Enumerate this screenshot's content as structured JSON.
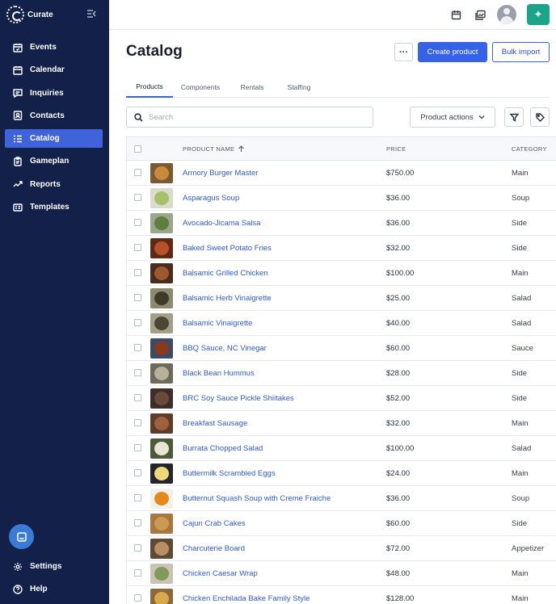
{
  "app": {
    "logo_text": "Curate",
    "page_title": "Catalog"
  },
  "sidebar": {
    "items": [
      {
        "label": "Events",
        "icon": "calendar-check-icon",
        "active": false
      },
      {
        "label": "Calendar",
        "icon": "calendar-icon",
        "active": false
      },
      {
        "label": "Inquiries",
        "icon": "message-icon",
        "active": false
      },
      {
        "label": "Contacts",
        "icon": "contact-card-icon",
        "active": false
      },
      {
        "label": "Catalog",
        "icon": "list-icon",
        "active": true
      },
      {
        "label": "Gameplan",
        "icon": "clipboard-icon",
        "active": false
      },
      {
        "label": "Reports",
        "icon": "trend-icon",
        "active": false
      },
      {
        "label": "Templates",
        "icon": "template-icon",
        "active": false
      }
    ],
    "bottom_items": [
      {
        "label": "Settings",
        "icon": "gear-icon"
      },
      {
        "label": "Help",
        "icon": "help-icon"
      }
    ]
  },
  "header": {
    "more_label": "···",
    "create_label": "Create product",
    "import_label": "Bulk import"
  },
  "tabs": [
    {
      "label": "Products",
      "active": true
    },
    {
      "label": "Components",
      "active": false
    },
    {
      "label": "Rentals",
      "active": false
    },
    {
      "label": "Staffing",
      "active": false
    }
  ],
  "toolbar": {
    "search_placeholder": "Search",
    "actions_label": "Product actions"
  },
  "table": {
    "columns": {
      "name": "PRODUCT NAME",
      "price": "PRICE",
      "category": "CATEGORY"
    },
    "rows": [
      {
        "name": "Armory Burger Master",
        "price": "$750.00",
        "category": "Main",
        "bg": "#7a5a32",
        "food": "#c98b3a"
      },
      {
        "name": "Asparagus Soup",
        "price": "$36.00",
        "category": "Soup",
        "bg": "#d9dccb",
        "food": "#a7c06a"
      },
      {
        "name": "Avocado-Jicama Salsa",
        "price": "$36.00",
        "category": "Side",
        "bg": "#9aa58b",
        "food": "#5f7d3e"
      },
      {
        "name": "Baked Sweet Potato Fries",
        "price": "$32.00",
        "category": "Side",
        "bg": "#5c2b18",
        "food": "#b9502a"
      },
      {
        "name": "Balsamic Grilled Chicken",
        "price": "$100.00",
        "category": "Main",
        "bg": "#4a2c1c",
        "food": "#9a5a2e"
      },
      {
        "name": "Balsamic Herb Vinaigrette",
        "price": "$25.00",
        "category": "Salad",
        "bg": "#8c8a6e",
        "food": "#3d3a2a"
      },
      {
        "name": "Balsamic Vinaigrette",
        "price": "$40.00",
        "category": "Salad",
        "bg": "#a39e86",
        "food": "#4c4636"
      },
      {
        "name": "BBQ Sauce, NC Vinegar",
        "price": "$60.00",
        "category": "Sauce",
        "bg": "#3b4a66",
        "food": "#8a3a1c"
      },
      {
        "name": "Black Bean Hummus",
        "price": "$28.00",
        "category": "Side",
        "bg": "#6e6a5a",
        "food": "#b7b09a"
      },
      {
        "name": "BRC Soy Sauce Pickle Shiitakes",
        "price": "$52.00",
        "category": "Side",
        "bg": "#3e2e2a",
        "food": "#6b4a3c"
      },
      {
        "name": "Breakfast Sausage",
        "price": "$32.00",
        "category": "Main",
        "bg": "#5e3b2a",
        "food": "#a0603c"
      },
      {
        "name": "Burrata Chopped Salad",
        "price": "$100.00",
        "category": "Salad",
        "bg": "#4d5a3a",
        "food": "#e8e3d4"
      },
      {
        "name": "Buttermilk Scrambled Eggs",
        "price": "$24.00",
        "category": "Main",
        "bg": "#23252c",
        "food": "#f0d778"
      },
      {
        "name": "Butternut Squash Soup with Creme Fraiche",
        "price": "$36.00",
        "category": "Soup",
        "bg": "#f2f0ea",
        "food": "#e48a1c"
      },
      {
        "name": "Cajun Crab Cakes",
        "price": "$60.00",
        "category": "Side",
        "bg": "#a8763e",
        "food": "#c99a52"
      },
      {
        "name": "Charcuterie Board",
        "price": "$72.00",
        "category": "Appetizer",
        "bg": "#5f4a36",
        "food": "#b88e62"
      },
      {
        "name": "Chicken Caesar Wrap",
        "price": "$48.00",
        "category": "Main",
        "bg": "#c8c3b3",
        "food": "#7f9a5a"
      },
      {
        "name": "Chicken Enchilada Bake Family Style",
        "price": "$128.00",
        "category": "Main",
        "bg": "#8a6a3a",
        "food": "#d8a84a"
      }
    ]
  }
}
